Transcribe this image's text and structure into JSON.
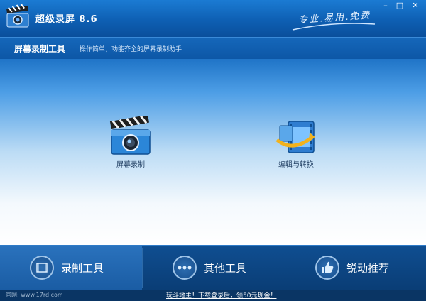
{
  "window": {
    "title": "超级录屏 8.6",
    "slogan": "专业.易用.免费"
  },
  "window_controls": {
    "minimize": "–",
    "maximize": "□",
    "close": "✕"
  },
  "subheader": {
    "title": "屏幕录制工具",
    "description": "操作简单，功能齐全的屏幕录制助手"
  },
  "tools": [
    {
      "label": "屏幕录制",
      "icon": "clapperboard-camera-icon"
    },
    {
      "label": "编辑与转换",
      "icon": "film-convert-icon"
    }
  ],
  "bottom_nav": [
    {
      "label": "录制工具",
      "icon": "film-icon",
      "active": true
    },
    {
      "label": "其他工具",
      "icon": "more-dots-icon",
      "active": false
    },
    {
      "label": "锐动推荐",
      "icon": "thumbs-up-icon",
      "active": false
    }
  ],
  "statusbar": {
    "site": "官网: www.17rd.com",
    "promo": "玩斗地主！下载登录后，领50元现金！"
  },
  "colors": {
    "titlebar": "#0e5fb3",
    "bottom_nav": "#0a3d75",
    "accent": "#1f74c7"
  }
}
